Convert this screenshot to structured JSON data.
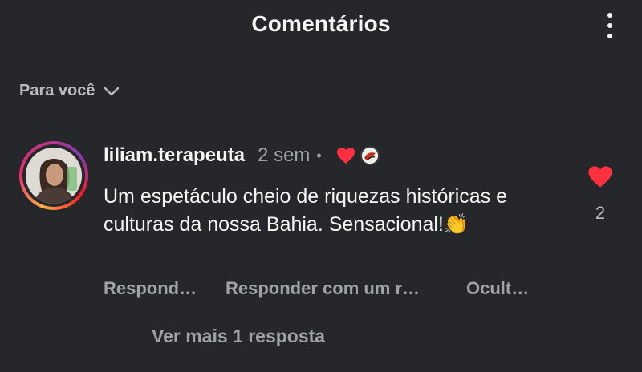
{
  "header": {
    "title": "Comentários",
    "menu_icon": "more-vertical-icon"
  },
  "filter": {
    "label": "Para você",
    "icon": "chevron-down-icon"
  },
  "comment": {
    "username": "liliam.terapeuta",
    "time_ago": "2 sem",
    "separator": "•",
    "text": "Um espetáculo cheio de riquezas históricas e culturas da nossa Bahia. Sensacional!👏",
    "creator_liked": true,
    "likes": "2",
    "liked": true,
    "like_color": "#ff3040",
    "actions": {
      "reply": "Respond…",
      "reply_with_photo": "Responder com um r…",
      "hide": "Ocult…"
    },
    "more_replies": "Ver mais 1 resposta"
  }
}
